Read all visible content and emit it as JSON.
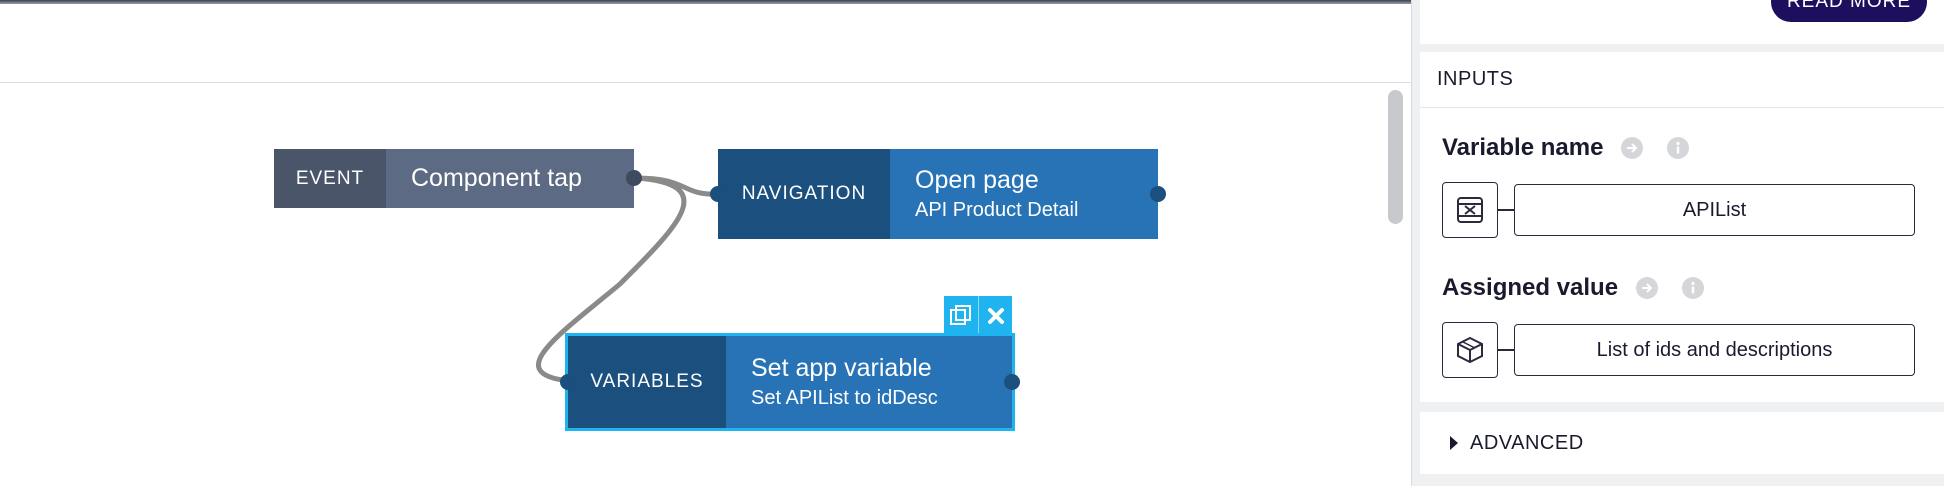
{
  "canvas": {
    "event_node": {
      "category": "EVENT",
      "title": "Component tap"
    },
    "navigation_node": {
      "category": "NAVIGATION",
      "title": "Open page",
      "subtitle": "API Product Detail"
    },
    "variables_node": {
      "category": "VARIABLES",
      "title": "Set app variable",
      "subtitle": "Set APIList to idDesc"
    },
    "node_actions": {
      "duplicate_icon": "copy-icon",
      "delete_icon": "close-icon"
    }
  },
  "panel": {
    "read_more_label": "READ MORE",
    "inputs_header": "INPUTS",
    "fields": [
      {
        "label": "Variable name",
        "value": "APIList",
        "type_icon": "variable-icon"
      },
      {
        "label": "Assigned value",
        "value": "List of ids and descriptions",
        "type_icon": "cube-icon"
      }
    ],
    "advanced_label": "ADVANCED"
  },
  "colors": {
    "event_category": "#4a5569",
    "event_body": "#5c6a84",
    "node_category": "#1b4f7e",
    "node_body": "#2773b5",
    "selection": "#1fb4ef",
    "read_more_button": "#1e0e5e"
  }
}
